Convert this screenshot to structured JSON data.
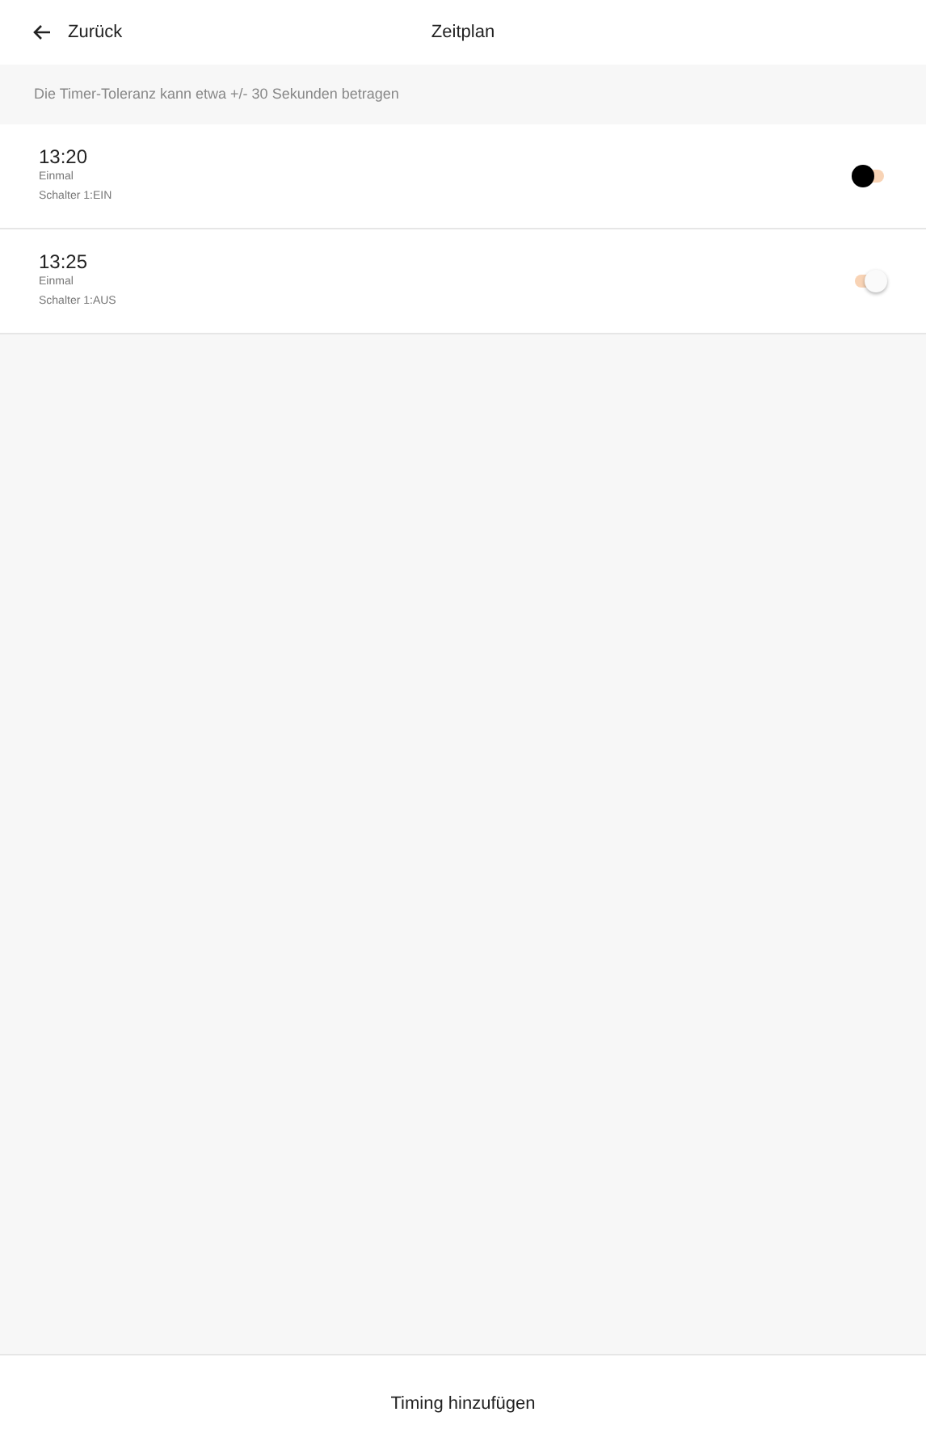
{
  "header": {
    "back_label": "Zurück",
    "title": "Zeitplan"
  },
  "notice": "Die Timer-Toleranz kann etwa +/- 30 Sekunden betragen",
  "timers": [
    {
      "time": "13:20",
      "repeat": "Einmal",
      "action": "Schalter 1:EIN",
      "on": false
    },
    {
      "time": "13:25",
      "repeat": "Einmal",
      "action": "Schalter 1:AUS",
      "on": true
    }
  ],
  "footer_button": "Timing hinzufügen"
}
